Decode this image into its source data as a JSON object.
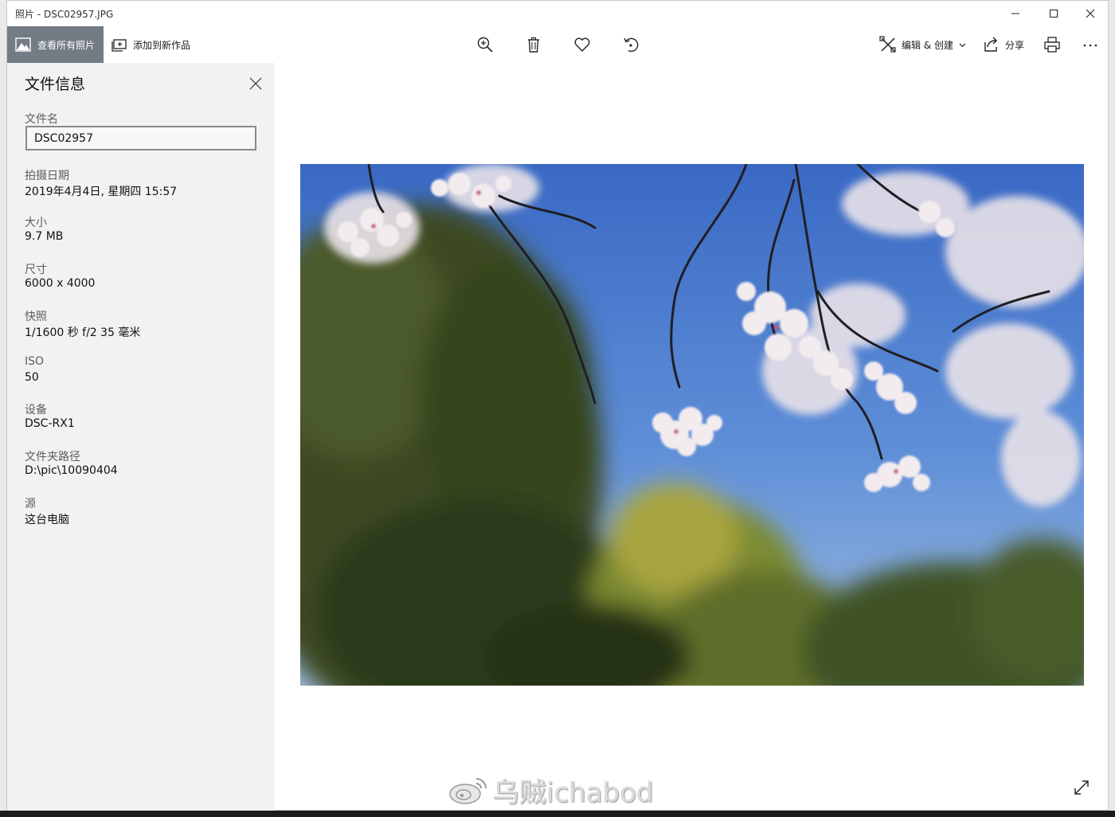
{
  "window": {
    "title": "照片 - DSC02957.JPG"
  },
  "toolbar": {
    "view_all_label": "查看所有照片",
    "add_creation_label": "添加到新作品",
    "edit_create_label": "编辑 & 创建",
    "share_label": "分享"
  },
  "file_info": {
    "title": "文件信息",
    "filename_label": "文件名",
    "filename_value": "DSC02957",
    "date_label": "拍摄日期",
    "date_value": "2019年4月4日, 星期四 15:57",
    "size_label": "大小",
    "size_value": "9.7 MB",
    "dimensions_label": "尺寸",
    "dimensions_value": "6000 x 4000",
    "shutter_label": "快照",
    "shutter_value": "1/1600 秒 f/2 35 毫米",
    "iso_label": "ISO",
    "iso_value": "50",
    "device_label": "设备",
    "device_value": "DSC-RX1",
    "folder_label": "文件夹路径",
    "folder_value": "D:\\pic\\10090404",
    "source_label": "源",
    "source_value": "这台电脑"
  },
  "watermark": {
    "text": "乌贼ichabod"
  }
}
